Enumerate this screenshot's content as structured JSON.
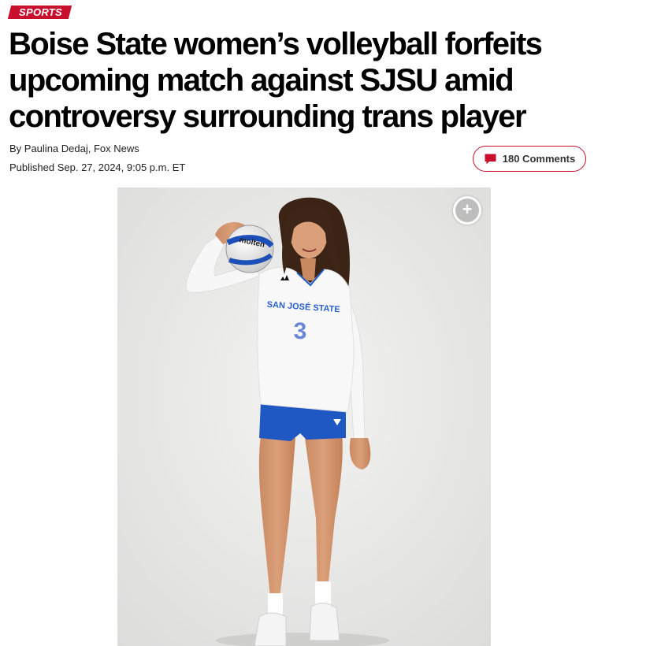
{
  "section": {
    "label": "SPORTS",
    "color": "#c8102e"
  },
  "article": {
    "headline": "Boise State women’s volleyball forfeits upcoming match against SJSU amid controversy surrounding trans player",
    "byline": "By Paulina Dedaj, Fox News",
    "published": "Published Sep. 27, 2024, 9:05 p.m. ET"
  },
  "comments": {
    "label": "180 Comments",
    "icon": "comment-bubble-icon"
  },
  "photo": {
    "jersey_text": "SAN JOSÉ STATE",
    "jersey_number": "3",
    "ball_brand": "molten",
    "expand_icon": "plus-icon"
  }
}
